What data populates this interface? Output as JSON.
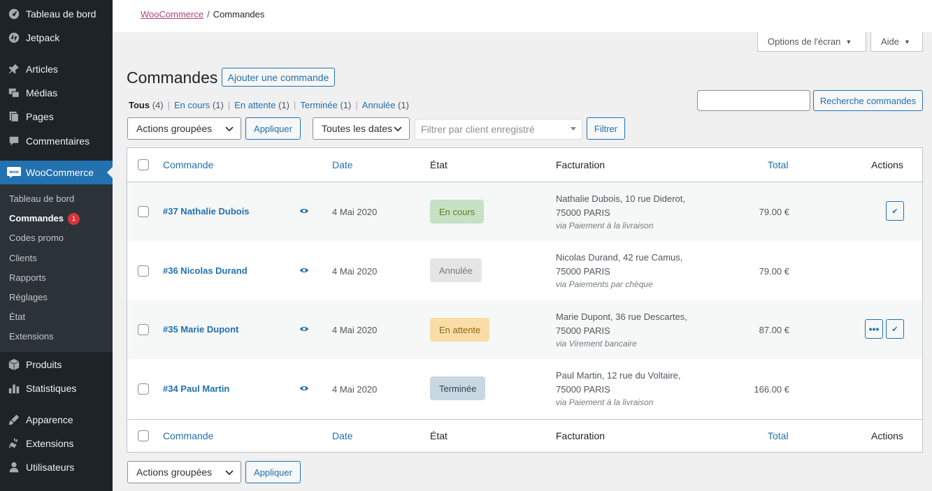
{
  "sidebar": {
    "top_items": [
      {
        "label": "Tableau de bord",
        "icon": "dashboard-icon"
      },
      {
        "label": "Jetpack",
        "icon": "jetpack-icon"
      },
      {
        "label": "Articles",
        "icon": "pin-icon"
      },
      {
        "label": "Médias",
        "icon": "media-icon"
      },
      {
        "label": "Pages",
        "icon": "pages-icon"
      },
      {
        "label": "Commentaires",
        "icon": "comment-icon"
      },
      {
        "label": "WooCommerce",
        "icon": "woo-icon"
      }
    ],
    "submenu": [
      {
        "label": "Tableau de bord"
      },
      {
        "label": "Commandes",
        "badge": "1"
      },
      {
        "label": "Codes promo"
      },
      {
        "label": "Clients"
      },
      {
        "label": "Rapports"
      },
      {
        "label": "Réglages"
      },
      {
        "label": "État"
      },
      {
        "label": "Extensions"
      }
    ],
    "bottom_items": [
      {
        "label": "Produits",
        "icon": "products-icon"
      },
      {
        "label": "Statistiques",
        "icon": "stats-icon"
      },
      {
        "label": "Apparence",
        "icon": "appearance-icon"
      },
      {
        "label": "Extensions",
        "icon": "plugin-icon"
      },
      {
        "label": "Utilisateurs",
        "icon": "users-icon"
      }
    ]
  },
  "breadcrumb": {
    "parent": "WooCommerce",
    "separator": "/",
    "current": "Commandes"
  },
  "screen_options": {
    "label": "Options de l'écran",
    "help": "Aide"
  },
  "page": {
    "title": "Commandes",
    "add_button": "Ajouter une commande"
  },
  "filters": {
    "views": [
      {
        "label": "Tous",
        "count": "(4)"
      },
      {
        "label": "En cours",
        "count": "(1)"
      },
      {
        "label": "En attente",
        "count": "(1)"
      },
      {
        "label": "Terminée",
        "count": "(1)"
      },
      {
        "label": "Annulée",
        "count": "(1)"
      }
    ],
    "separator": "|",
    "bulk_actions": "Actions groupées",
    "apply": "Appliquer",
    "dates": "Toutes les dates",
    "customer_placeholder": "Filtrer par client enregistré",
    "filter_button": "Filtrer",
    "search_button": "Recherche commandes",
    "search_value": ""
  },
  "table": {
    "columns": {
      "order": "Commande",
      "date": "Date",
      "status": "État",
      "billing": "Facturation",
      "total": "Total",
      "actions": "Actions"
    },
    "rows": [
      {
        "order": "#37 Nathalie Dubois",
        "date": "4 Mai 2020",
        "status": "En cours",
        "status_key": "processing",
        "billing_line1": "Nathalie Dubois, 10 rue Diderot,",
        "billing_line2": "75000 PARIS",
        "billing_via": "via Paiement à la livraison",
        "total": "79.00 €",
        "actions": [
          "complete"
        ]
      },
      {
        "order": "#36 Nicolas Durand",
        "date": "4 Mai 2020",
        "status": "Annulée",
        "status_key": "cancelled",
        "billing_line1": "Nicolas Durand, 42 rue Camus,",
        "billing_line2": "75000 PARIS",
        "billing_via": "via Paiements par chèque",
        "total": "79.00 €",
        "actions": []
      },
      {
        "order": "#35 Marie Dupont",
        "date": "4 Mai 2020",
        "status": "En attente",
        "status_key": "onhold",
        "billing_line1": "Marie Dupont, 36 rue Descartes,",
        "billing_line2": "75000 PARIS",
        "billing_via": "via Virement bancaire",
        "total": "87.00 €",
        "actions": [
          "processing",
          "complete"
        ]
      },
      {
        "order": "#34 Paul Martin",
        "date": "4 Mai 2020",
        "status": "Terminée",
        "status_key": "completed",
        "billing_line1": "Paul Martin, 12 rue du Voltaire,",
        "billing_line2": "75000 PARIS",
        "billing_via": "via Paiement à la livraison",
        "total": "166.00 €",
        "actions": []
      }
    ]
  },
  "bottom": {
    "bulk_actions": "Actions groupées",
    "apply": "Appliquer"
  },
  "colors": {
    "sidebar": "#1d2327",
    "accent": "#2271b1",
    "badge": "#d63638"
  }
}
